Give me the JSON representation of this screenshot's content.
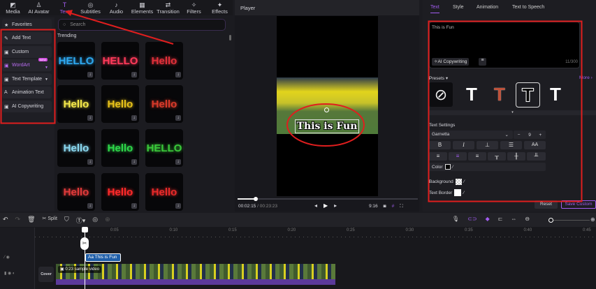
{
  "nav": [
    {
      "label": "Media",
      "icon": "media-icon"
    },
    {
      "label": "AI Avatar",
      "icon": "avatar-icon"
    },
    {
      "label": "Text",
      "icon": "text-icon",
      "active": true
    },
    {
      "label": "Subtitles",
      "icon": "subtitles-icon"
    },
    {
      "label": "Audio",
      "icon": "audio-icon"
    },
    {
      "label": "Elements",
      "icon": "elements-icon"
    },
    {
      "label": "Transition",
      "icon": "transition-icon"
    },
    {
      "label": "Filters",
      "icon": "filters-icon"
    },
    {
      "label": "Effects",
      "icon": "effects-icon"
    }
  ],
  "sidebar": {
    "items": [
      {
        "label": "Favorites"
      },
      {
        "label": "Add Text"
      },
      {
        "label": "Custom"
      },
      {
        "label": "WordArt",
        "badge": "NEW"
      },
      {
        "label": "Text Template"
      },
      {
        "label": "Animation Text"
      },
      {
        "label": "AI Copywriting"
      }
    ]
  },
  "search": {
    "placeholder": "Search"
  },
  "library": {
    "section": "Trending",
    "tiles": [
      {
        "text": "HELLO",
        "color": "#2ea8f0"
      },
      {
        "text": "HELLO",
        "color": "#ff3a5a"
      },
      {
        "text": "Hello",
        "color": "#e0303a"
      },
      {
        "text": "Hello",
        "color": "#f5e94a"
      },
      {
        "text": "Hello",
        "color": "#e8c21a"
      },
      {
        "text": "Hello",
        "color": "#d83a2a"
      },
      {
        "text": "Hello",
        "color": "#8ad8f0"
      },
      {
        "text": "Hello",
        "color": "#2ed84a"
      },
      {
        "text": "HELLO",
        "color": "#3ac83a"
      },
      {
        "text": "Hello",
        "color": "#e03a3a"
      },
      {
        "text": "Hello",
        "color": "#ff2a2a"
      },
      {
        "text": "Hello",
        "color": "#e82a2a"
      }
    ]
  },
  "player": {
    "title": "Player",
    "overlay_text": "This is Fun",
    "current_time": "00:02:15",
    "total_time": "00:23:23",
    "progress": 0.1,
    "aspect": "9:16"
  },
  "right": {
    "tabs": [
      "Text",
      "Style",
      "Animation",
      "Text to Speech"
    ],
    "text_value": "This is Fun",
    "ai_button": "AI Copywriting",
    "char_count": "11/300",
    "presets_label": "Presets",
    "more_label": "More",
    "settings_label": "Text Settings",
    "font": "Garnetta",
    "size": "9",
    "color_label": "Color",
    "background_label": "Background",
    "border_label": "Text Border",
    "reset": "Reset",
    "save_custom": "Save Custom"
  },
  "timeline": {
    "split": "Split",
    "ruler": [
      "0:05",
      "0:10",
      "0:15",
      "0:20",
      "0:25",
      "0:30",
      "0:35",
      "0:40",
      "0:45"
    ],
    "text_clip": "Aa This is Fun",
    "video_clip": "0:23 sample video",
    "cover": "Cover"
  },
  "accent": "#a25cf0",
  "annotation": "#e01e1e"
}
